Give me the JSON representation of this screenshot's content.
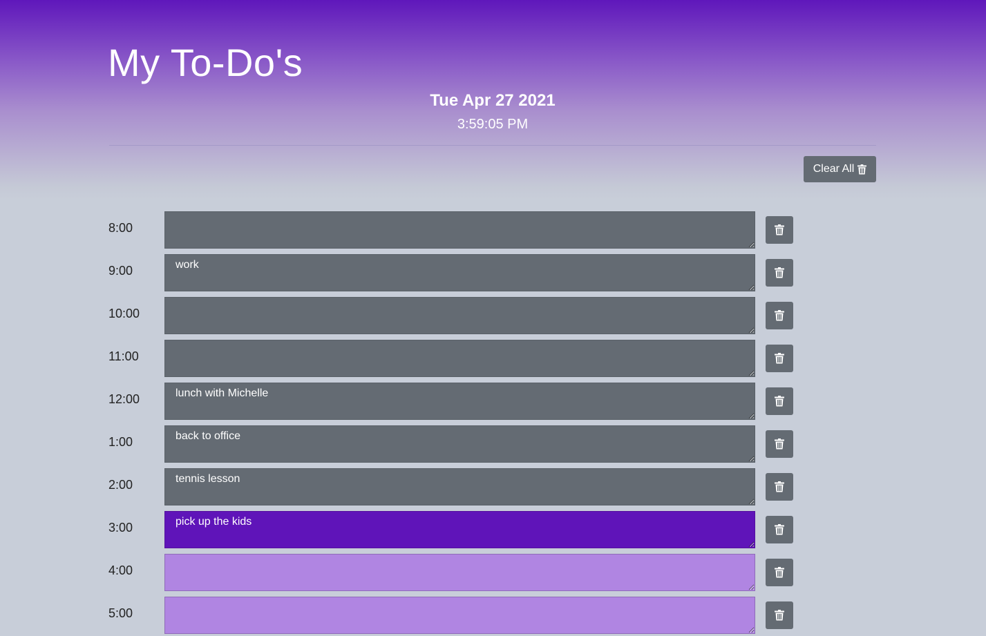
{
  "header": {
    "title": "My To-Do's",
    "date": "Tue Apr 27 2021",
    "time": "3:59:05 PM"
  },
  "toolbar": {
    "clear_all_label": "Clear All",
    "clear_all_icon": "trash-icon"
  },
  "colors": {
    "past": "#646b73",
    "present": "#5f14b9",
    "future": "#b085e2",
    "button": "#646b73"
  },
  "schedule": [
    {
      "hour": "8:00",
      "task": "",
      "state": "past"
    },
    {
      "hour": "9:00",
      "task": "work",
      "state": "past"
    },
    {
      "hour": "10:00",
      "task": "",
      "state": "past"
    },
    {
      "hour": "11:00",
      "task": "",
      "state": "past"
    },
    {
      "hour": "12:00",
      "task": "lunch with Michelle",
      "state": "past"
    },
    {
      "hour": "1:00",
      "task": "back to office",
      "state": "past"
    },
    {
      "hour": "2:00",
      "task": "tennis lesson",
      "state": "past"
    },
    {
      "hour": "3:00",
      "task": "pick up the kids",
      "state": "present"
    },
    {
      "hour": "4:00",
      "task": "",
      "state": "future"
    },
    {
      "hour": "5:00",
      "task": "",
      "state": "future"
    }
  ]
}
